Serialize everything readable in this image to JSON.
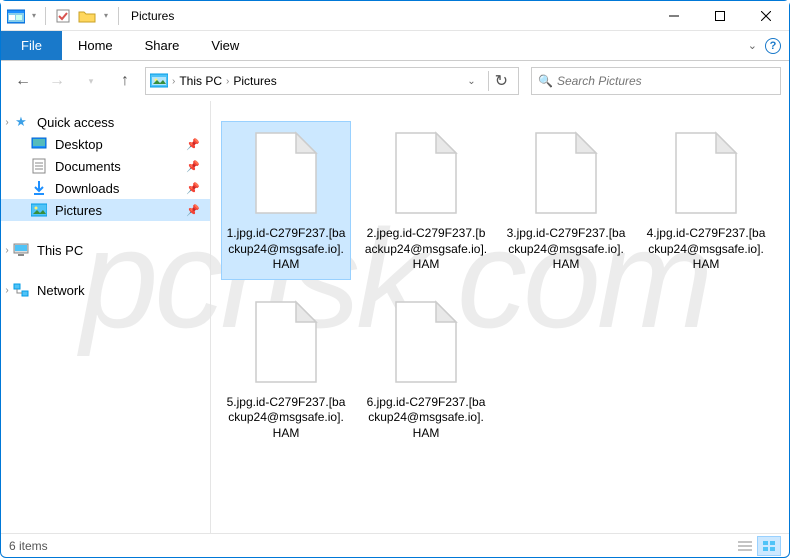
{
  "window": {
    "title": "Pictures"
  },
  "ribbon": {
    "file": "File",
    "tabs": [
      "Home",
      "Share",
      "View"
    ]
  },
  "breadcrumb": {
    "items": [
      "This PC",
      "Pictures"
    ]
  },
  "search": {
    "placeholder": "Search Pictures"
  },
  "sidebar": {
    "quick_access": {
      "label": "Quick access",
      "items": [
        {
          "label": "Desktop",
          "pinned": true
        },
        {
          "label": "Documents",
          "pinned": true
        },
        {
          "label": "Downloads",
          "pinned": true
        },
        {
          "label": "Pictures",
          "pinned": true,
          "selected": true
        }
      ]
    },
    "this_pc": {
      "label": "This PC"
    },
    "network": {
      "label": "Network"
    }
  },
  "files": [
    {
      "name": "1.jpg.id-C279F237.[backup24@msgsafe.io].HAM",
      "selected": true
    },
    {
      "name": "2.jpeg.id-C279F237.[backup24@msgsafe.io].HAM",
      "selected": false
    },
    {
      "name": "3.jpg.id-C279F237.[backup24@msgsafe.io].HAM",
      "selected": false
    },
    {
      "name": "4.jpg.id-C279F237.[backup24@msgsafe.io].HAM",
      "selected": false
    },
    {
      "name": "5.jpg.id-C279F237.[backup24@msgsafe.io].HAM",
      "selected": false
    },
    {
      "name": "6.jpg.id-C279F237.[backup24@msgsafe.io].HAM",
      "selected": false
    }
  ],
  "status": {
    "item_count": "6 items"
  },
  "watermark": "pcrisk.com"
}
